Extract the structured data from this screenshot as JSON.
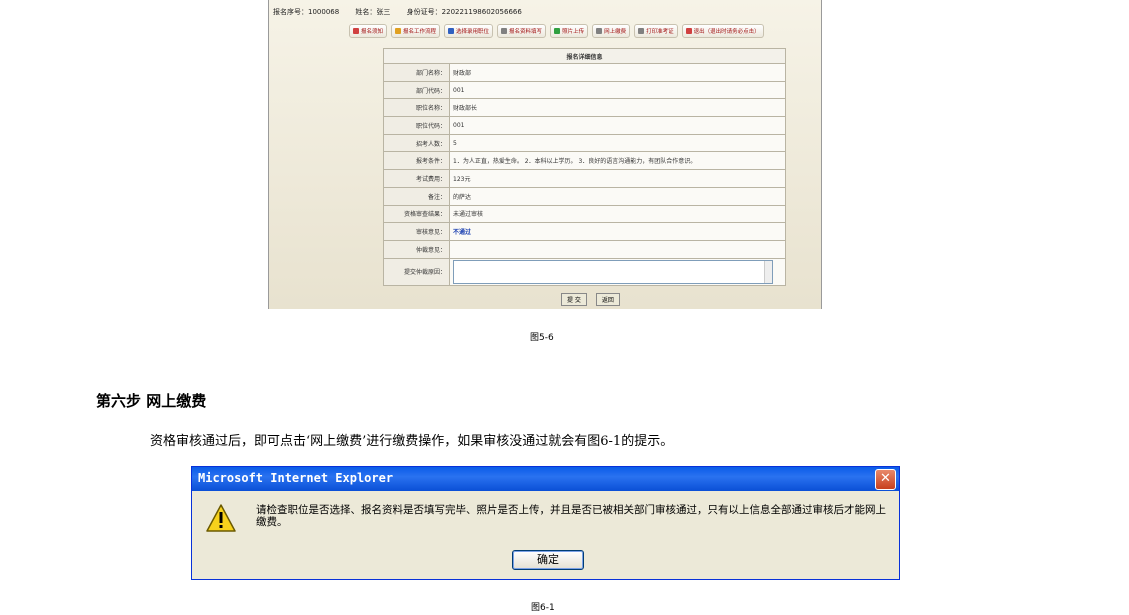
{
  "info_bar": {
    "reg_no_label": "报名序号：",
    "reg_no": "1000068",
    "name_label": "姓名：",
    "name": "张三",
    "id_label": "身份证号：",
    "id_no": "220221198602056666"
  },
  "toolbar": [
    {
      "label": "报名须知",
      "icon": "info-icon",
      "color": "#d04040"
    },
    {
      "label": "报名工作流程",
      "icon": "flow-icon",
      "color": "#e0a020"
    },
    {
      "label": "选择录用职位",
      "icon": "position-icon",
      "color": "#3060c0"
    },
    {
      "label": "报名资料填写",
      "icon": "form-icon",
      "color": "#808080"
    },
    {
      "label": "照片上传",
      "icon": "photo-icon",
      "color": "#30a040"
    },
    {
      "label": "网上缴费",
      "icon": "pay-icon",
      "color": "#808080"
    },
    {
      "label": "打印准考证",
      "icon": "print-icon",
      "color": "#808080"
    },
    {
      "label": "退出（退出时请务必点击）",
      "icon": "exit-icon",
      "color": "#d04040"
    }
  ],
  "detail": {
    "header": "报名详细信息",
    "rows": [
      {
        "label": "部门名称：",
        "value": "财政部"
      },
      {
        "label": "部门代码：",
        "value": "001"
      },
      {
        "label": "职位名称：",
        "value": "财政部长"
      },
      {
        "label": "职位代码：",
        "value": "001"
      },
      {
        "label": "招考人数：",
        "value": "5"
      },
      {
        "label": "报考条件：",
        "value": "1．为人正直，热爱生命。 2．本科以上学历。 3．良好的语言沟通能力，有团队合作意识。"
      },
      {
        "label": "考试费用：",
        "value": "123元"
      },
      {
        "label": "备注：",
        "value": "的萨达"
      },
      {
        "label": "资格审查结果：",
        "value": "未通过审核"
      },
      {
        "label": "审核意见：",
        "value": "不通过"
      },
      {
        "label": "仲裁意见：",
        "value": ""
      }
    ],
    "appeal_label": "提交仲裁原因："
  },
  "shot_buttons": {
    "submit": "提 交",
    "back": "返回"
  },
  "caption1": "图5-6",
  "step_title": "第六步  网上缴费",
  "paragraph": "资格审核通过后，即可点击‘网上缴费’进行缴费操作，如果审核没通过就会有图6-1的提示。",
  "dialog": {
    "title": "Microsoft Internet Explorer",
    "message": "请检查职位是否选择、报名资料是否填写完毕、照片是否上传，并且是否已被相关部门审核通过，只有以上信息全部通过审核后才能网上缴费。",
    "ok": "确定",
    "close_glyph": "✕"
  },
  "caption2": "图6-1"
}
